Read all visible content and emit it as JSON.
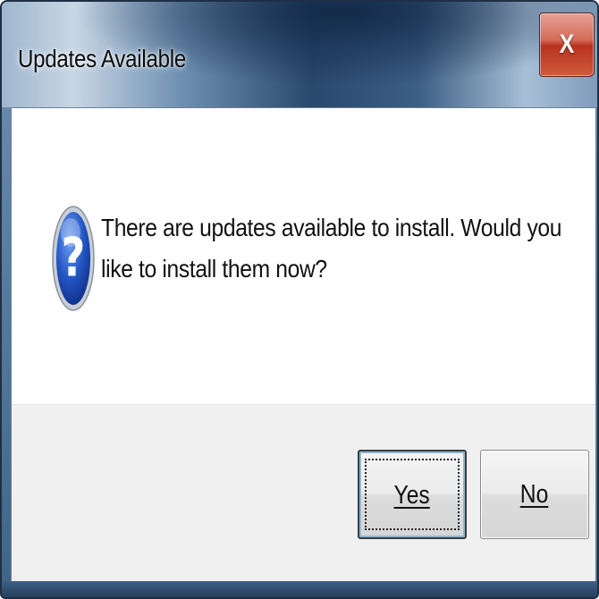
{
  "window": {
    "title": "Updates Available",
    "close_label": "X"
  },
  "dialog": {
    "icon": "question-icon",
    "message": "There are updates available to install. Would you like to install them now?"
  },
  "buttons": {
    "yes_label": "Yes",
    "no_label": "No",
    "default": "yes"
  },
  "colors": {
    "title_bar": "#3c5f85",
    "close_button": "#c8462f",
    "client_background": "#ffffff",
    "button_area": "#f0f0f0",
    "focus_glow": "#8db8d8"
  }
}
